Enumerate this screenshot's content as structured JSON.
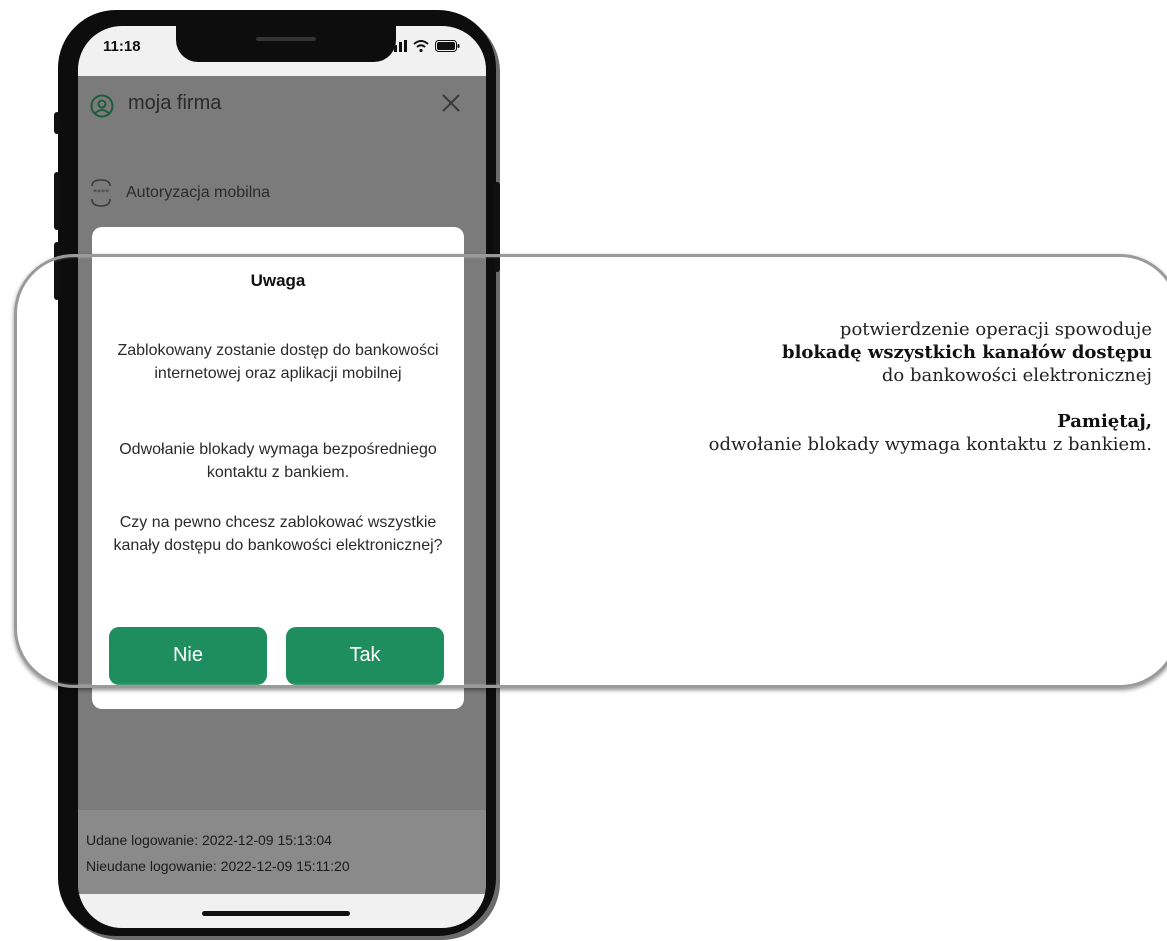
{
  "status_bar": {
    "time": "11:18"
  },
  "menu": {
    "title": "moja firma",
    "items": [
      {
        "label": "Autoryzacja mobilna"
      }
    ]
  },
  "dialog": {
    "title": "Uwaga",
    "message_1": "Zablokowany zostanie dostęp do bankowości internetowej oraz aplikacji mobilnej",
    "message_2": "Odwołanie blokady wymaga bezpośredniego kontaktu z bankiem.",
    "message_3": "Czy na pewno chcesz zablokować wszystkie kanały dostępu do bankowości elektronicznej?",
    "no_label": "Nie",
    "yes_label": "Tak",
    "button_color": "#1e8e5e"
  },
  "footer": {
    "successful_login": "Udane logowanie: 2022-12-09 15:13:04",
    "failed_login": "Nieudane logowanie: 2022-12-09 15:11:20"
  },
  "callout": {
    "line1": "potwierdzenie operacji spowoduje",
    "line2_bold": "blokadę wszystkich kanałów dostępu",
    "line3": "do bankowości elektronicznej",
    "line4_bold": "Pamiętaj,",
    "line5": "odwołanie blokady wymaga kontaktu z bankiem."
  }
}
